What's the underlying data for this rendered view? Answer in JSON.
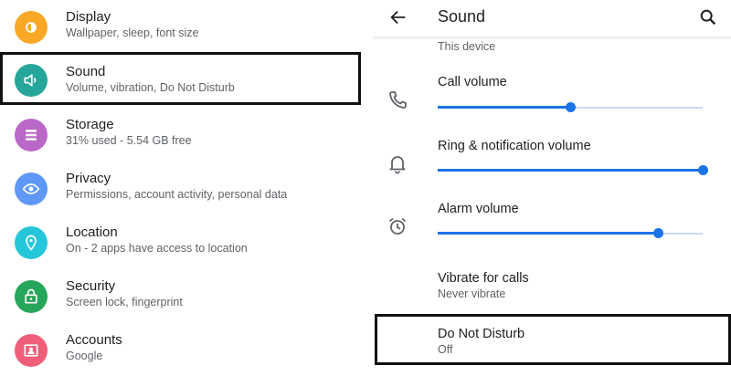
{
  "left": {
    "items": [
      {
        "title": "Display",
        "subtitle": "Wallpaper, sleep, font size",
        "icon": "display-icon",
        "color": "#f9a825"
      },
      {
        "title": "Sound",
        "subtitle": "Volume, vibration, Do Not Disturb",
        "icon": "volume-icon",
        "color": "#26a69a"
      },
      {
        "title": "Storage",
        "subtitle": "31% used - 5.54 GB free",
        "icon": "storage-icon",
        "color": "#ba68c8"
      },
      {
        "title": "Privacy",
        "subtitle": "Permissions, account activity, personal data",
        "icon": "eye-icon",
        "color": "#5e97f6"
      },
      {
        "title": "Location",
        "subtitle": "On - 2 apps have access to location",
        "icon": "location-icon",
        "color": "#26c6da"
      },
      {
        "title": "Security",
        "subtitle": "Screen lock, fingerprint",
        "icon": "lock-icon",
        "color": "#26a65b"
      },
      {
        "title": "Accounts",
        "subtitle": "Google",
        "icon": "account-icon",
        "color": "#ef5f7a"
      }
    ]
  },
  "right": {
    "title": "Sound",
    "clipped_top_text": "This device",
    "volumes": [
      {
        "label": "Call volume",
        "icon": "phone-icon",
        "level": 0.5
      },
      {
        "label": "Ring & notification volume",
        "icon": "bell-icon",
        "level": 1.0
      },
      {
        "label": "Alarm volume",
        "icon": "alarm-icon",
        "level": 0.83
      }
    ],
    "vibrate": {
      "title": "Vibrate for calls",
      "subtitle": "Never vibrate"
    },
    "dnd": {
      "title": "Do Not Disturb",
      "subtitle": "Off"
    },
    "accent_color": "#1a73e8"
  }
}
